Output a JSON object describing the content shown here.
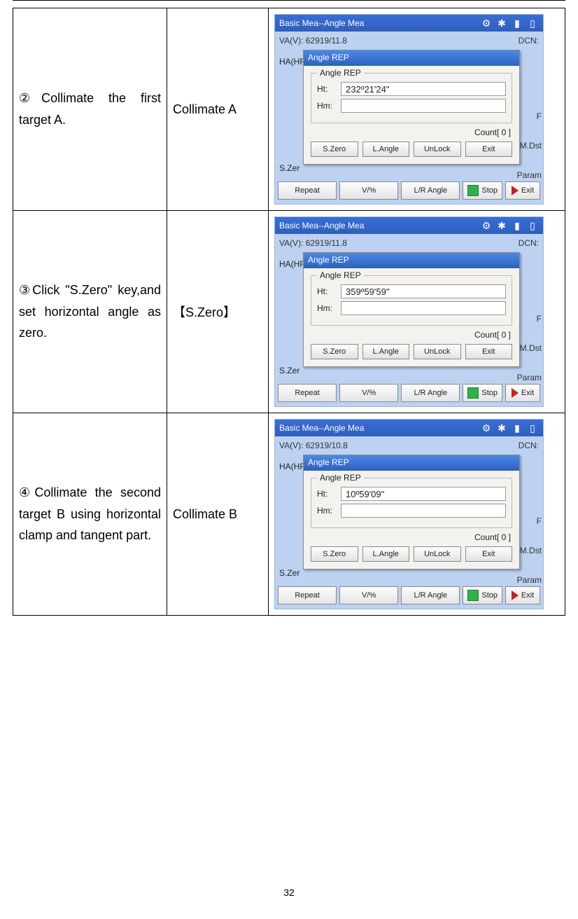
{
  "page_number": "32",
  "rows": [
    {
      "description": "②Collimate the first target A.",
      "action": "Collimate A",
      "screen": {
        "title": "Basic Mea--Angle Mea",
        "va_label": "VA(V):",
        "va_value": "62919/11.8",
        "dcn": "DCN:",
        "hahr": "HA(HR):",
        "dialog_title": "Angle REP",
        "group_label": "Angle REP",
        "ht_label": "Ht:",
        "ht_value": "232º21'24\"",
        "hm_label": "Hm:",
        "hm_value": "",
        "count": "Count[ 0 ]",
        "dlg_buttons": [
          "S.Zero",
          "L.Angle",
          "UnLock",
          "Exit"
        ],
        "side": [
          "F",
          "M.Dst",
          "Param"
        ],
        "th": "S.Zer",
        "bottom": [
          "Repeat",
          "V/%",
          "L/R Angle",
          "Stop",
          "Exit"
        ]
      }
    },
    {
      "description": "③Click \"S.Zero\" key,and set horizontal angle as zero.",
      "action": "【S.Zero】",
      "screen": {
        "title": "Basic Mea--Angle Mea",
        "va_label": "VA(V):",
        "va_value": "62919/11.8",
        "dcn": "DCN:",
        "hahr": "HA(HR):",
        "dialog_title": "Angle REP",
        "group_label": "Angle REP",
        "ht_label": "Ht:",
        "ht_value": "359º59'59\"",
        "hm_label": "Hm:",
        "hm_value": "",
        "count": "Count[ 0 ]",
        "dlg_buttons": [
          "S.Zero",
          "L.Angle",
          "UnLock",
          "Exit"
        ],
        "side": [
          "F",
          "M.Dst",
          "Param"
        ],
        "th": "S.Zer",
        "bottom": [
          "Repeat",
          "V/%",
          "L/R Angle",
          "Stop",
          "Exit"
        ]
      }
    },
    {
      "description": "④Collimate the second target B using horizontal clamp and tangent part.",
      "action": "Collimate B",
      "screen": {
        "title": "Basic Mea--Angle Mea",
        "va_label": "VA(V):",
        "va_value": "62919/10.8",
        "dcn": "DCN:",
        "hahr": "HA(HR):",
        "dialog_title": "Angle REP",
        "group_label": "Angle REP",
        "ht_label": "Ht:",
        "ht_value": "10º59'09\"",
        "hm_label": "Hm:",
        "hm_value": "",
        "count": "Count[ 0 ]",
        "dlg_buttons": [
          "S.Zero",
          "L.Angle",
          "UnLock",
          "Exit"
        ],
        "side": [
          "F",
          "M.Dst",
          "Param"
        ],
        "th": "S.Zer",
        "bottom": [
          "Repeat",
          "V/%",
          "L/R Angle",
          "Stop",
          "Exit"
        ]
      }
    }
  ]
}
